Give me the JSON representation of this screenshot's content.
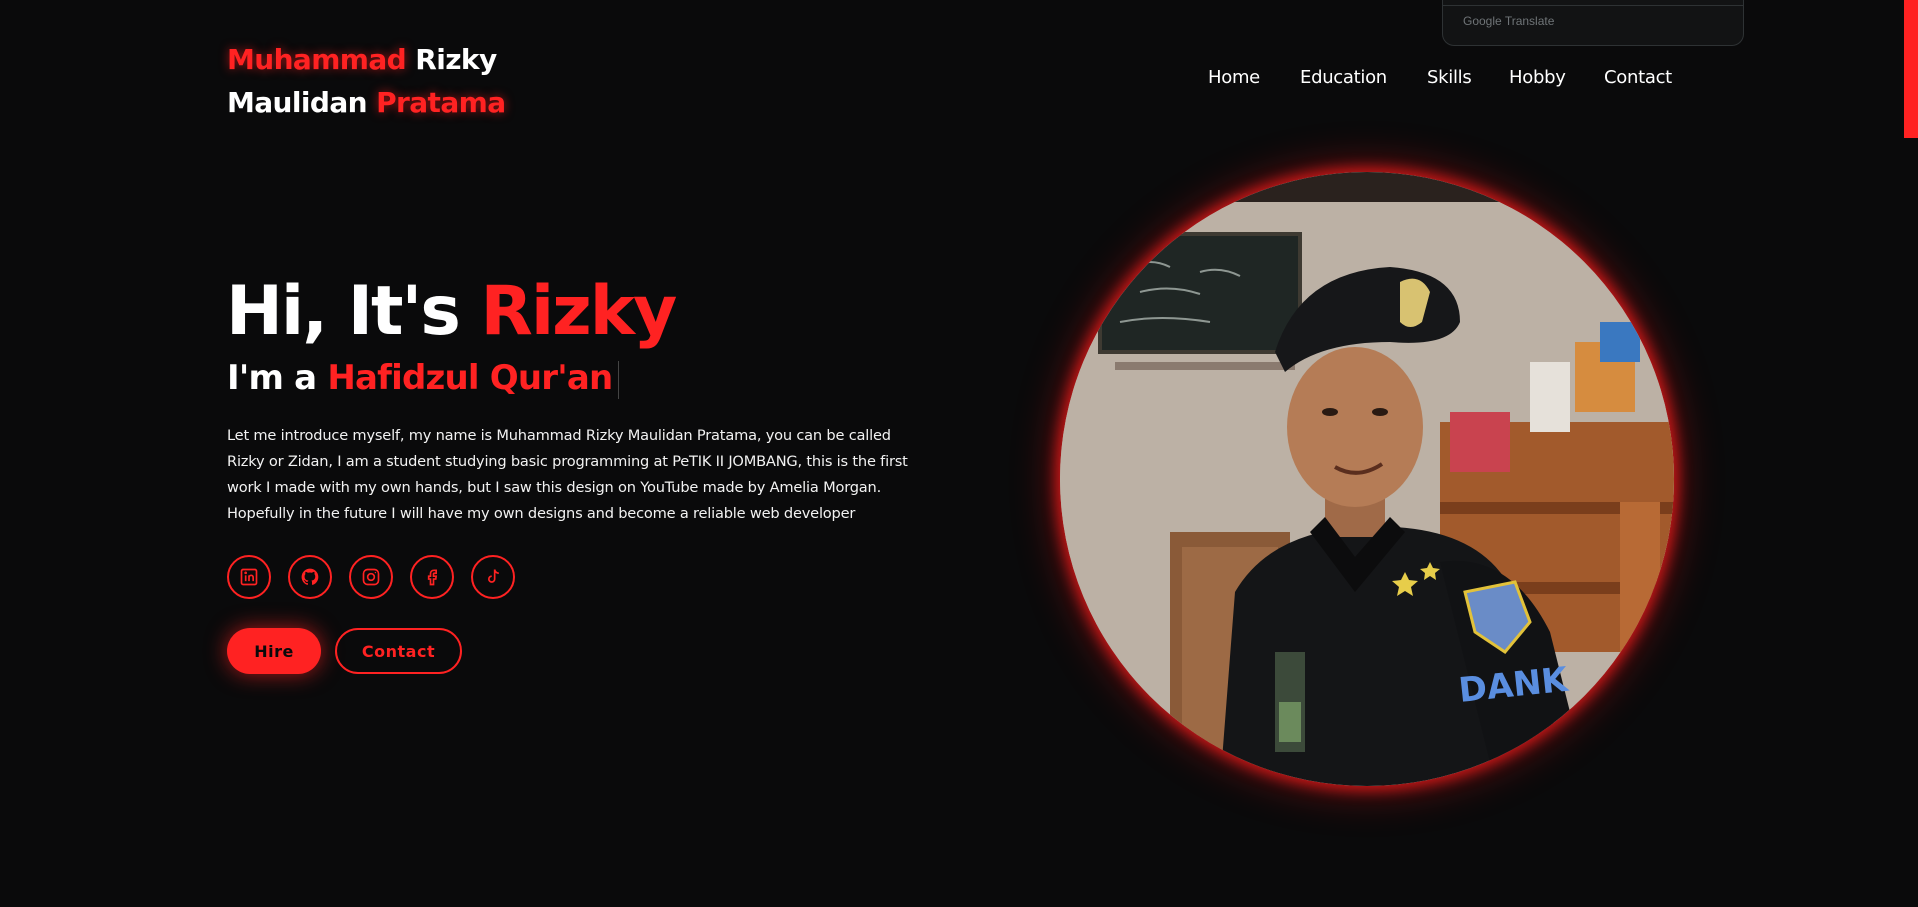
{
  "logo": {
    "word1": "Muhammad",
    "word2": "Rizky",
    "word3": "Maulidan",
    "word4": "Pratama"
  },
  "translate_widget": {
    "label": "Google Translate"
  },
  "nav": {
    "items": [
      {
        "label": "Home"
      },
      {
        "label": "Education"
      },
      {
        "label": "Skills"
      },
      {
        "label": "Hobby"
      },
      {
        "label": "Contact"
      }
    ]
  },
  "hero": {
    "greeting": "Hi, It's",
    "name": "Rizky",
    "sub_prefix": "I'm a",
    "role": "Hafidzul Qur'an",
    "description": "Let me introduce myself, my name is Muhammad Rizky Maulidan Pratama, you can be called Rizky or Zidan, I am a student studying basic programming at PeTIK II JOMBANG, this is the first work I made with my own hands, but I saw this design on YouTube made by Amelia Morgan. Hopefully in the future I will have my own designs and become a reliable web developer"
  },
  "socials": [
    {
      "icon": "linkedin-icon"
    },
    {
      "icon": "github-icon"
    },
    {
      "icon": "instagram-icon"
    },
    {
      "icon": "facebook-icon"
    },
    {
      "icon": "tiktok-icon"
    }
  ],
  "buttons": {
    "hire": "Hire",
    "contact": "Contact"
  },
  "profile_patch_text": "DANK",
  "colors": {
    "accent": "#ff2222",
    "background": "#0a0a0b",
    "text": "#ffffff"
  }
}
